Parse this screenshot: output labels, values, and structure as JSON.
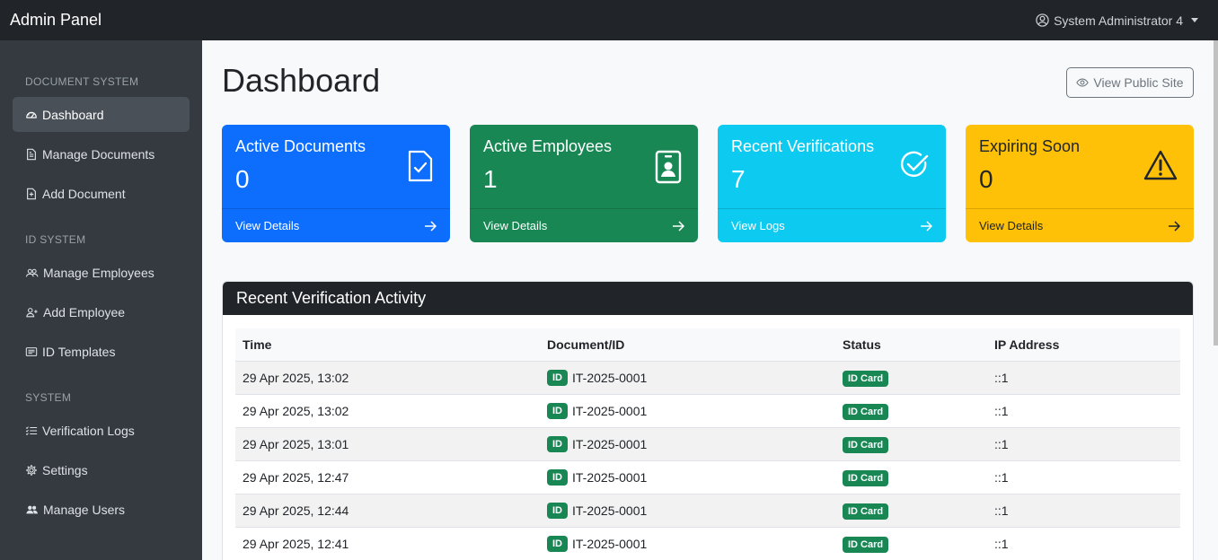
{
  "topbar": {
    "brand": "Admin Panel",
    "user": "System Administrator 4"
  },
  "sidebar": {
    "sections": [
      {
        "title": "DOCUMENT SYSTEM",
        "items": [
          {
            "label": "Dashboard",
            "icon": "speedometer-icon",
            "active": true
          },
          {
            "label": "Manage Documents",
            "icon": "file-text-icon"
          },
          {
            "label": "Add Document",
            "icon": "file-plus-icon"
          }
        ]
      },
      {
        "title": "ID SYSTEM",
        "items": [
          {
            "label": "Manage Employees",
            "icon": "people-icon"
          },
          {
            "label": "Add Employee",
            "icon": "person-plus-icon"
          },
          {
            "label": "ID Templates",
            "icon": "card-text-icon"
          }
        ]
      },
      {
        "title": "SYSTEM",
        "items": [
          {
            "label": "Verification Logs",
            "icon": "list-check-icon"
          },
          {
            "label": "Settings",
            "icon": "gear-icon"
          },
          {
            "label": "Manage Users",
            "icon": "people-fill-icon"
          }
        ]
      }
    ]
  },
  "main": {
    "title": "Dashboard",
    "public_button": "View Public Site",
    "cards": [
      {
        "label": "Active Documents",
        "value": "0",
        "link": "View Details",
        "icon": "file-check-icon",
        "color": "#0d6efd"
      },
      {
        "label": "Active Employees",
        "value": "1",
        "link": "View Details",
        "icon": "badge-icon",
        "color": "#198754"
      },
      {
        "label": "Recent Verifications",
        "value": "7",
        "link": "View Logs",
        "icon": "check-circle-icon",
        "color": "#0dcaf0"
      },
      {
        "label": "Expiring Soon",
        "value": "0",
        "link": "View Details",
        "icon": "warning-icon",
        "color": "#ffc107"
      }
    ],
    "activity": {
      "title": "Recent Verification Activity",
      "columns": [
        "Time",
        "Document/ID",
        "Status",
        "IP Address"
      ],
      "rows": [
        {
          "time": "29 Apr 2025, 13:02",
          "type": "ID",
          "doc": "IT-2025-0001",
          "status": "ID Card",
          "ip": "::1"
        },
        {
          "time": "29 Apr 2025, 13:02",
          "type": "ID",
          "doc": "IT-2025-0001",
          "status": "ID Card",
          "ip": "::1"
        },
        {
          "time": "29 Apr 2025, 13:01",
          "type": "ID",
          "doc": "IT-2025-0001",
          "status": "ID Card",
          "ip": "::1"
        },
        {
          "time": "29 Apr 2025, 12:47",
          "type": "ID",
          "doc": "IT-2025-0001",
          "status": "ID Card",
          "ip": "::1"
        },
        {
          "time": "29 Apr 2025, 12:44",
          "type": "ID",
          "doc": "IT-2025-0001",
          "status": "ID Card",
          "ip": "::1"
        },
        {
          "time": "29 Apr 2025, 12:41",
          "type": "ID",
          "doc": "IT-2025-0001",
          "status": "ID Card",
          "ip": "::1"
        }
      ]
    }
  }
}
